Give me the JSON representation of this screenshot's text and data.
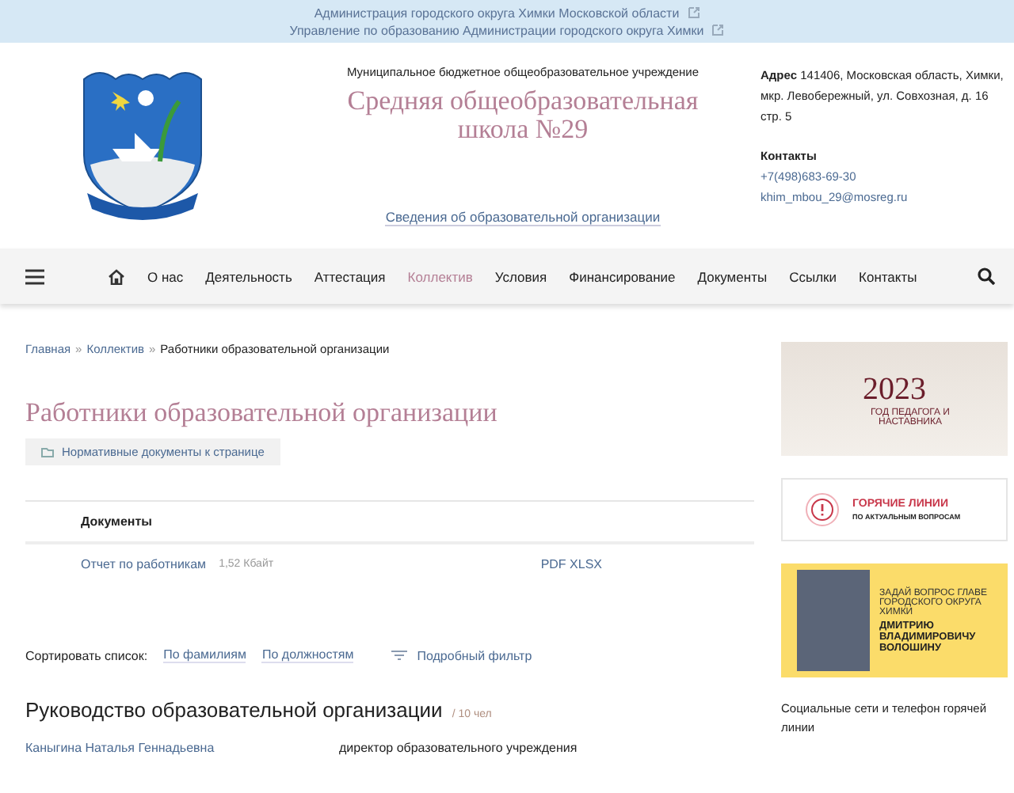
{
  "top_links": [
    {
      "label": "Администрация городского округа Химки Московской области"
    },
    {
      "label": "Управление по образованию Администрации городского округа Химки"
    }
  ],
  "header": {
    "subtitle": "Муниципальное бюджетное общеобразовательное учреждение",
    "title": "Средняя общеобразовательная школа №29",
    "info_link": "Сведения об образовательной организации",
    "address_label": "Адрес",
    "address": "141406, Московская область, Химки, мкр. Левобережный, ул. Совхозная, д. 16 стр. 5",
    "contacts_label": "Контакты",
    "phone": "+7(498)683-69-30",
    "email": "khim_mbou_29@mosreg.ru"
  },
  "nav": [
    {
      "label": "О нас",
      "selected": false
    },
    {
      "label": "Деятельность",
      "selected": false
    },
    {
      "label": "Аттестация",
      "selected": false
    },
    {
      "label": "Коллектив",
      "selected": true
    },
    {
      "label": "Условия",
      "selected": false
    },
    {
      "label": "Финансирование",
      "selected": false
    },
    {
      "label": "Документы",
      "selected": false
    },
    {
      "label": "Ссылки",
      "selected": false
    },
    {
      "label": "Контакты",
      "selected": false
    }
  ],
  "breadcrumb_separator": "»",
  "breadcrumbs": [
    {
      "label": "Главная",
      "link": true
    },
    {
      "label": "Коллектив",
      "link": true
    },
    {
      "label": "Работники образовательной организации",
      "link": false
    }
  ],
  "page_title": "Работники образовательной организации",
  "docs_button": "Нормативные документы к странице",
  "documents": {
    "heading": "Документы",
    "rows": [
      {
        "name": "Отчет по работникам",
        "size": "1,52 Кбайт",
        "formats": "PDF XLSX"
      }
    ]
  },
  "sort": {
    "label": "Сортировать список:",
    "options": [
      "По фамилиям",
      "По должностям"
    ],
    "filter": "Подробный фильтр"
  },
  "section": {
    "title": "Руководство образовательной организации",
    "count": "/ 10 чел",
    "people": [
      {
        "name": "Каныгина Наталья Геннадьевна",
        "position": "директор образовательного учреждения"
      }
    ]
  },
  "sidebar": {
    "year_banner": {
      "year": "2023",
      "text": "ГОД ПЕДАГОГА И НАСТАВНИКА"
    },
    "hotline_banner": {
      "title": "ГОРЯЧИЕ ЛИНИИ",
      "subtitle": "ПО АКТУАЛЬНЫМ ВОПРОСАМ"
    },
    "question_banner": {
      "text": "ЗАДАЙ ВОПРОС ГЛАВЕ ГОРОДСКОГО ОКРУГА ХИМКИ",
      "name": "ДМИТРИЮ ВЛАДИМИРОВИЧУ ВОЛОШИНУ"
    },
    "social_text": "Социальные сети и телефон горячей линии"
  }
}
